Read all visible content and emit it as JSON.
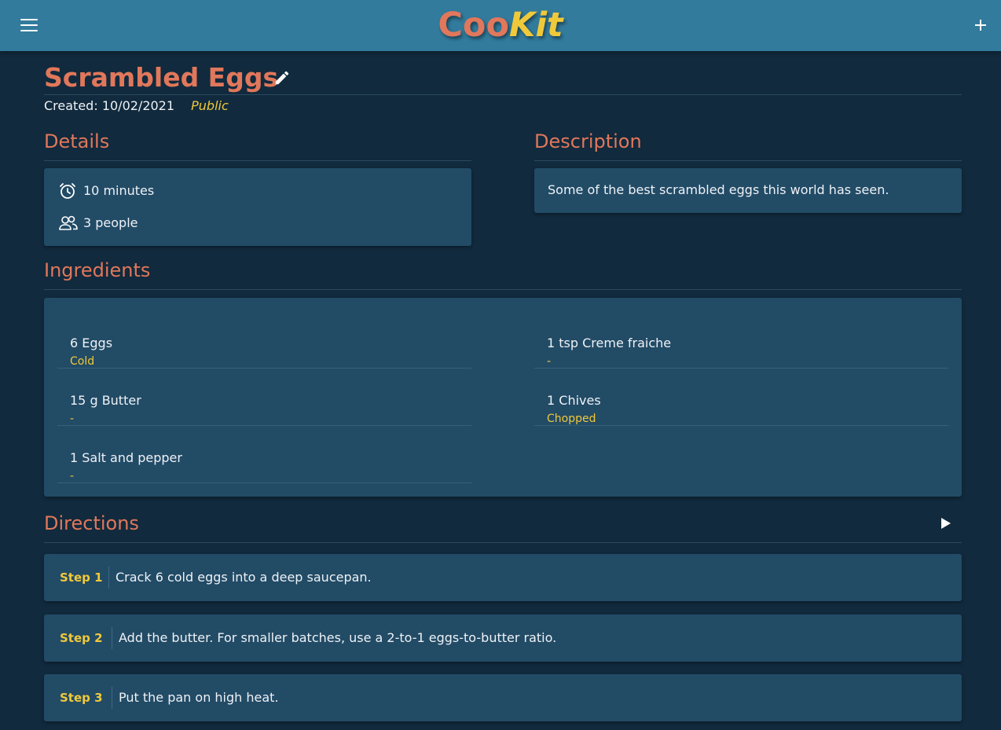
{
  "colors": {
    "header_bg": "#327b9d",
    "page_bg": "#112a3d",
    "card_bg": "#224b66",
    "accent_orange": "#e1775b",
    "accent_yellow": "#f0c93a"
  },
  "header": {
    "logo_part1": "Coo",
    "logo_part2": "Kit",
    "menu_icon": "hamburger-icon",
    "add_icon": "plus-icon"
  },
  "recipe": {
    "title": "Scrambled Eggs",
    "created_label": "Created:",
    "created_date": "10/02/2021",
    "visibility": "Public",
    "edit_icon": "pencil-icon"
  },
  "details": {
    "heading": "Details",
    "time": "10 minutes",
    "time_icon": "alarm-clock-icon",
    "servings": "3 people",
    "servings_icon": "people-icon"
  },
  "description": {
    "heading": "Description",
    "text": "Some of the best scrambled eggs this world has seen."
  },
  "ingredients": {
    "heading": "Ingredients",
    "items": [
      {
        "name": "6 Eggs",
        "note": "Cold"
      },
      {
        "name": "1 tsp Creme fraiche",
        "note": "-"
      },
      {
        "name": "15 g Butter",
        "note": "-"
      },
      {
        "name": "1 Chives",
        "note": "Chopped"
      },
      {
        "name": "1 Salt and pepper",
        "note": "-"
      }
    ]
  },
  "directions": {
    "heading": "Directions",
    "play_icon": "play-icon",
    "steps": [
      {
        "label": "Step 1",
        "text": "Crack 6 cold eggs into a deep saucepan."
      },
      {
        "label": "Step 2",
        "text": "Add the butter. For smaller batches, use a 2-to-1 eggs-to-butter ratio."
      },
      {
        "label": "Step 3",
        "text": "Put the pan on high heat."
      }
    ]
  }
}
